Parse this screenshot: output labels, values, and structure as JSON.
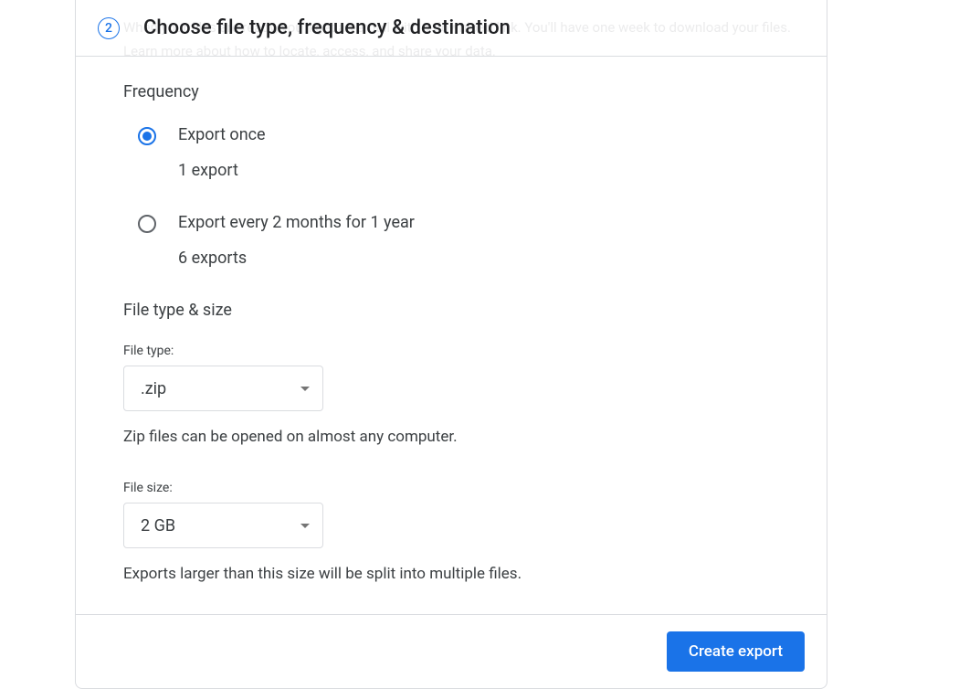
{
  "header": {
    "ghost_text": "When your files are ready, you'll get an email with a download link. You'll have one week to download your files. Learn more about how to locate, access, and share your data.",
    "step_number": "2",
    "step_title": "Choose file type, frequency & destination"
  },
  "frequency": {
    "heading": "Frequency",
    "options": [
      {
        "title": "Export once",
        "sub": "1 export",
        "selected": true
      },
      {
        "title": "Export every 2 months for 1 year",
        "sub": "6 exports",
        "selected": false
      }
    ]
  },
  "filetype": {
    "heading": "File type & size",
    "type_label": "File type:",
    "type_value": ".zip",
    "type_helper": "Zip files can be opened on almost any computer.",
    "size_label": "File size:",
    "size_value": "2 GB",
    "size_helper": "Exports larger than this size will be split into multiple files."
  },
  "footer": {
    "create_label": "Create export"
  }
}
